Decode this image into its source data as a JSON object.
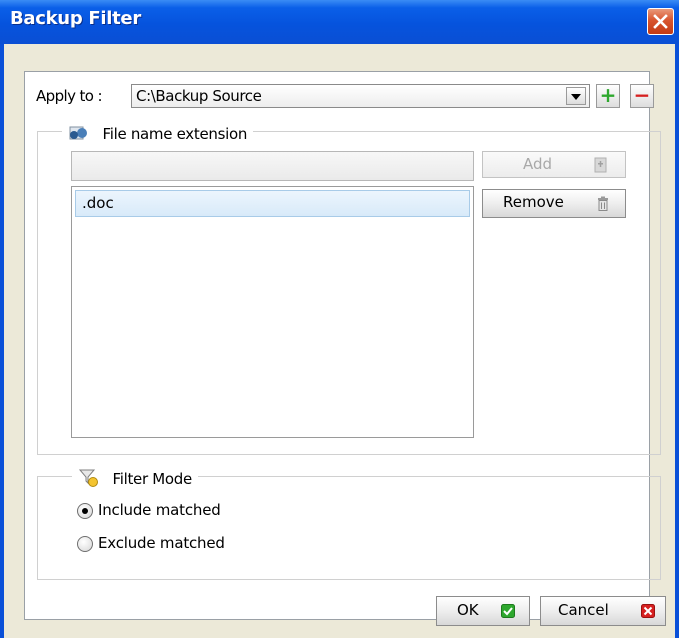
{
  "window": {
    "title": "Backup Filter"
  },
  "apply_to": {
    "label": "Apply to :",
    "selected": "C:\\Backup Source",
    "add_symbol": "+",
    "remove_symbol": "−"
  },
  "file_ext_group": {
    "legend": "File name extension",
    "input_value": "",
    "add_label": "Add",
    "remove_label": "Remove",
    "items": [
      ".doc"
    ]
  },
  "filter_mode_group": {
    "legend": "Filter Mode",
    "options": [
      {
        "label": "Include matched",
        "checked": true
      },
      {
        "label": "Exclude matched",
        "checked": false
      }
    ]
  },
  "footer": {
    "ok_label": "OK",
    "cancel_label": "Cancel"
  },
  "colors": {
    "titlebar": "#0653dd",
    "dialog_bg": "#ece9d8",
    "ok_icon": "#2ea82e",
    "cancel_icon": "#d62020",
    "plus": "#2ea82e",
    "minus": "#d62020"
  }
}
